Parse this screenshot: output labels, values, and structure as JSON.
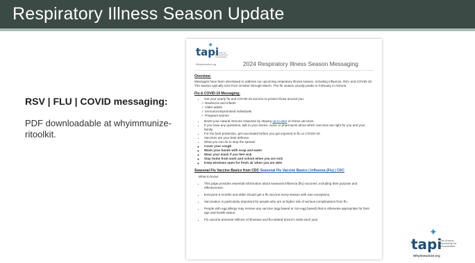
{
  "slide": {
    "title": "Respiratory Illness Season Update",
    "heading": "RSV | FLU | COVID messaging:",
    "description": "PDF downloadable at whyimmunize-ritoolkit."
  },
  "document": {
    "logo_word": "tapi",
    "logo_tagline": "The Arizona Partnership for Immunization",
    "logo_sub": "WhyImmunize.org",
    "title": "2024 Respiratory Illness Season Messaging",
    "overview_heading": "Overview:",
    "overview_text": "Messages have been developed to address our upcoming respiratory illness season, including influenza, RSV and COVID-19. The season typically runs from October through March. The flu season usually peaks in February in Arizona.",
    "flu_covid_heading": "Flu & COVID-19 Messaging:",
    "bullet_1": "Get your yearly flu and COVID-19 vaccine to protect those around you:",
    "checks": [
      "Newborns and infants",
      "Older adults",
      "Immunocompromised individuals",
      "Pregnant women"
    ],
    "bullet_2_pre": "Boost your natural immune response by staying ",
    "bullet_2_link": "up-to-date",
    "bullet_2_post": " on these vaccines.",
    "bullet_3": "If you have any questions, talk to your doctor, nurse or pharmacist about which vaccines are right for you and your family.",
    "bullet_4": "For the best protection, get vaccinated before you get exposed to flu or COVID-19.",
    "bullet_5": "Vaccines are your best defense.",
    "bullet_6": "What you can do to stop the spread:",
    "spread": [
      "Cover your cough",
      "Wash your hands with soap and water",
      "Wear your mask if you feel sick",
      "Stay home from work and school when you are sick",
      "Keep windows open for fresh air when you are able"
    ],
    "cdc_heading": "Seasonal Flu Vaccine Basics from CDC",
    "cdc_link": "Seasonal Flu Vaccine Basics | Influenza (Flu) | CDC",
    "what_to_know": "What to know:",
    "know": [
      "This page provides essential information about seasonal influenza (flu) vaccines, including their purpose and effectiveness.",
      "Everyone 6 months and older should get a flu vaccine every season with rare exceptions.",
      "Vaccination is particularly important for people who are at higher risk of serious complications from flu.",
      "People with egg allergy may receive any vaccine (egg based or non-egg based) that is otherwise appropriate for their age and health status.",
      "Flu vaccine prevents millions of illnesses and flu-related doctor's visits each year."
    ]
  },
  "corner_logo": {
    "word": "tapi",
    "tagline": "The Arizona Partnership for Immunization",
    "site": "WhyImmunize.org"
  },
  "colors": {
    "title_bar": "#3b4a44",
    "title_accent": "#a9bdb3",
    "logo_blue": "#1d4f7a",
    "link_blue": "#2a5db0"
  },
  "icons": {
    "logo_star": "star-icon"
  }
}
